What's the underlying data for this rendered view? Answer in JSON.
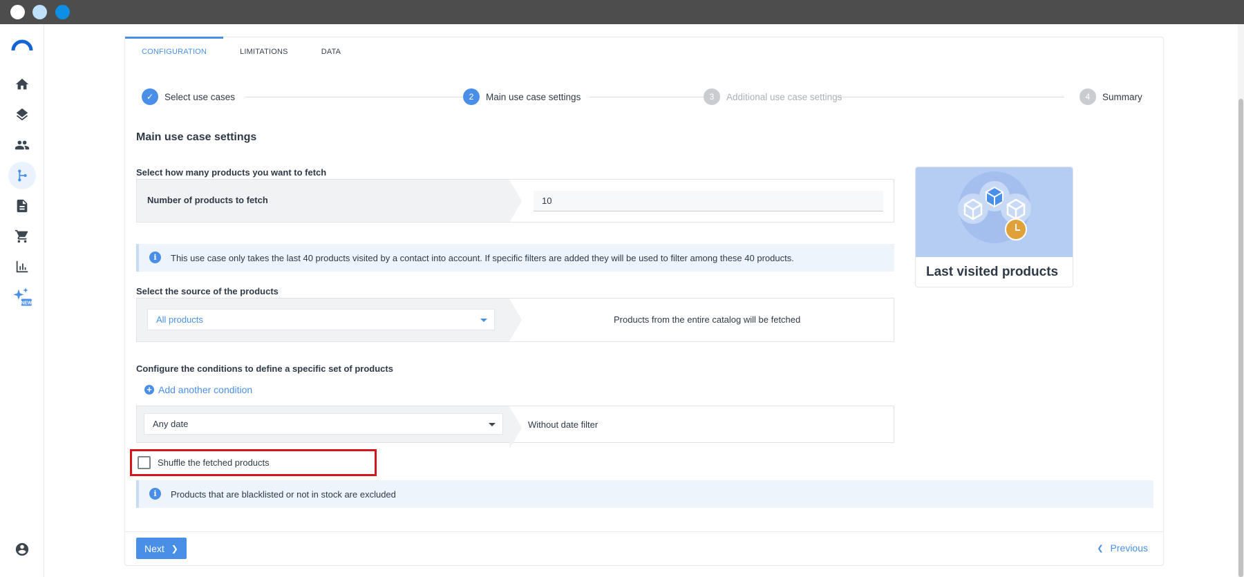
{
  "tabs": [
    {
      "label": "CONFIGURATION",
      "active": true
    },
    {
      "label": "LIMITATIONS",
      "active": false
    },
    {
      "label": "DATA",
      "active": false
    }
  ],
  "stepper": {
    "steps": [
      {
        "number": "✓",
        "label": "Select use cases",
        "state": "done"
      },
      {
        "number": "2",
        "label": "Main use case settings",
        "state": "current"
      },
      {
        "number": "3",
        "label": "Additional use case settings",
        "state": "future"
      },
      {
        "number": "4",
        "label": "Summary",
        "state": "future"
      }
    ]
  },
  "section_title": "Main use case settings",
  "fetch": {
    "label": "Select how many products you want to fetch",
    "row_label": "Number of products to fetch",
    "value": "10"
  },
  "info1": "This use case only takes the last 40 products visited by a contact into account. If specific filters are added they will be used to filter among these 40 products.",
  "source": {
    "label": "Select the source of the products",
    "selected": "All products",
    "description": "Products from the entire catalog will be fetched"
  },
  "conditions": {
    "label": "Configure the conditions to define a specific set of products",
    "add_label": "Add another condition",
    "date_selected": "Any date",
    "date_description": "Without date filter"
  },
  "shuffle": {
    "label": "Shuffle the fetched products",
    "checked": false
  },
  "info2": "Products that are blacklisted or not in stock are excluded",
  "preview": {
    "title": "Last visited products"
  },
  "footer": {
    "next_label": "Next",
    "previous_label": "Previous"
  },
  "sidebar": {
    "items": [
      {
        "icon": "home-icon"
      },
      {
        "icon": "layers-icon"
      },
      {
        "icon": "people-icon"
      },
      {
        "icon": "scenario-branch-icon",
        "active": true
      },
      {
        "icon": "document-icon"
      },
      {
        "icon": "cart-icon"
      },
      {
        "icon": "bar-chart-icon"
      },
      {
        "icon": "sparkles-new-icon",
        "badge": "NEW"
      }
    ]
  },
  "colors": {
    "accent": "#4a8fe7",
    "highlight_border": "#d4161c",
    "info_background": "#eef4fc"
  }
}
